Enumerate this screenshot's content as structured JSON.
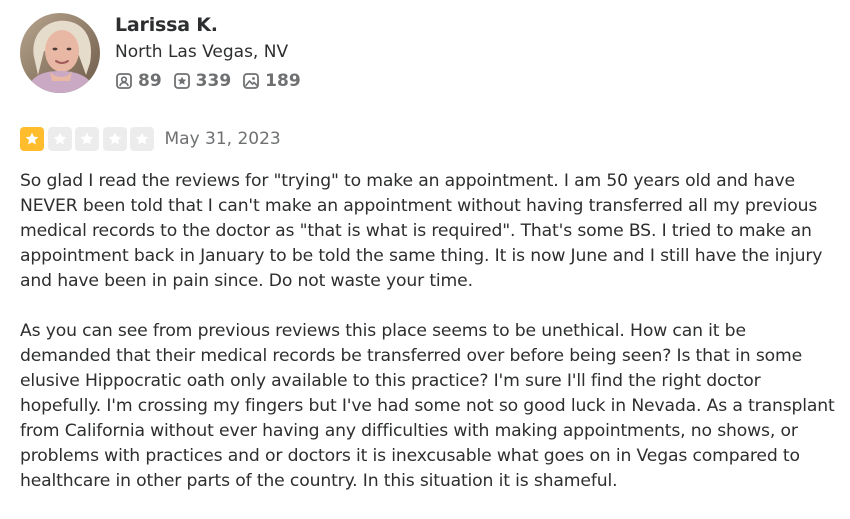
{
  "reviewer": {
    "name": "Larissa K.",
    "location": "North Las Vegas, NV",
    "stats": {
      "friends": "89",
      "reviews": "339",
      "photos": "189"
    }
  },
  "review": {
    "rating": 1,
    "max_rating": 5,
    "date": "May 31, 2023",
    "paragraphs": [
      "So glad I read the reviews for \"trying\" to make an appointment. I am 50 years old and have NEVER been told that I can't make an appointment without having transferred all my previous medical records to the doctor as \"that is what is required\". That's some BS. I tried to make an appointment back in January to be told the same thing. It is now June and I still have the injury and have been in pain since. Do not waste your time.",
      "As you can see from previous reviews this place seems to be unethical. How can it be demanded that their medical records be transferred over before being seen? Is that in some elusive Hippocratic oath only available to this practice? I'm sure I'll find the right doctor hopefully. I'm crossing my fingers but I've had some not so good luck in Nevada. As a transplant from California without ever having any difficulties with making appointments, no shows, or problems with practices and or doctors it is inexcusable what goes on in Vegas compared to healthcare in other parts of the country. In this situation it is shameful."
    ]
  },
  "colors": {
    "star_filled": "#ffbd2d",
    "star_empty": "#ececec",
    "text_primary": "#2d2e2f",
    "text_secondary": "#6e7072"
  },
  "icons": {
    "friends": "friends-icon",
    "reviews": "review-star-icon",
    "photos": "photo-icon",
    "star": "star-icon"
  }
}
